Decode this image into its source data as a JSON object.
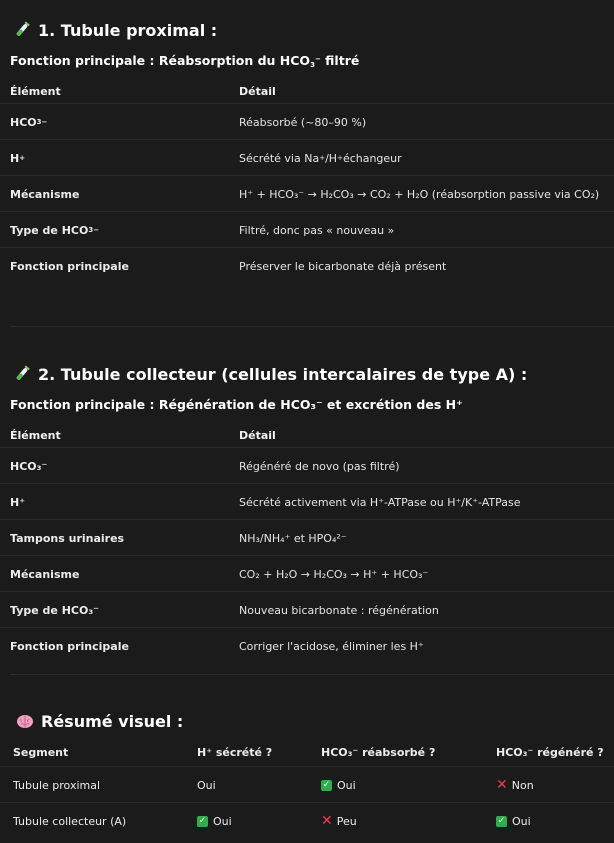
{
  "section1": {
    "heading": "1. Tubule proximal :",
    "function_label": "Fonction principale : Réabsorption du ",
    "function_tail": " filtré",
    "col_headers": [
      "Élément",
      "Détail"
    ],
    "rows": {
      "r1": {
        "label": "HCO",
        "detail": "Réabsorbé (~80–90 %)"
      },
      "r2": {
        "label": "H",
        "detail_a": "Sécrété via Na",
        "detail_b": "/H",
        "detail_c": " échangeur"
      },
      "r3": {
        "label": "Mécanisme",
        "detail": "H⁺ + HCO₃⁻ → H₂CO₃ → CO₂ + H₂O (réabsorption passive via CO₂)"
      },
      "r4": {
        "label": "Type de HCO",
        "detail": "Filtré, donc pas « nouveau »"
      },
      "r5": {
        "label": "Fonction principale",
        "detail": "Préserver le bicarbonate déjà présent"
      }
    }
  },
  "section2": {
    "heading": "2. Tubule collecteur (cellules intercalaires de type A) :",
    "function_label": "Fonction principale : Régénération de HCO₃⁻ et excrétion des H⁺",
    "col_headers": [
      "Élément",
      "Détail"
    ],
    "rows": {
      "r1": {
        "label": "HCO₃⁻",
        "detail": "Régénéré de novo (pas filtré)"
      },
      "r2": {
        "label": "H⁺",
        "detail": "Sécrété activement via H⁺-ATPase ou H⁺/K⁺-ATPase"
      },
      "r3": {
        "label": "Tampons urinaires",
        "detail": "NH₃/NH₄⁺ et HPO₄²⁻"
      },
      "r4": {
        "label": "Mécanisme",
        "detail": "CO₂ + H₂O → H₂CO₃ → H⁺ + HCO₃⁻"
      },
      "r5": {
        "label": "Type de HCO₃⁻",
        "detail": "Nouveau bicarbonate : régénération"
      },
      "r6": {
        "label": "Fonction principale",
        "detail": "Corriger l'acidose, éliminer les H⁺"
      }
    }
  },
  "summary": {
    "heading": "Résumé visuel :",
    "headers": [
      "Segment",
      "H⁺ sécrété ?",
      "HCO₃⁻ réabsorbé ?",
      "HCO₃⁻ régénéré ?"
    ],
    "rows": [
      {
        "segment": "Tubule proximal",
        "secrete": "Oui",
        "reabsorbe": "Oui",
        "regenere": "Non"
      },
      {
        "segment": "Tubule collecteur (A)",
        "secrete": "Oui",
        "reabsorbe": "Peu",
        "regenere": "Oui"
      }
    ]
  },
  "icons": {
    "section_icon": "test-tube-icon",
    "summary_icon": "brain-icon",
    "check": "check-icon",
    "cross": "cross-icon"
  },
  "colors": {
    "background": "#1b1b1b",
    "check_green": "#2fae4e",
    "cross_red": "#ef3b4f"
  }
}
